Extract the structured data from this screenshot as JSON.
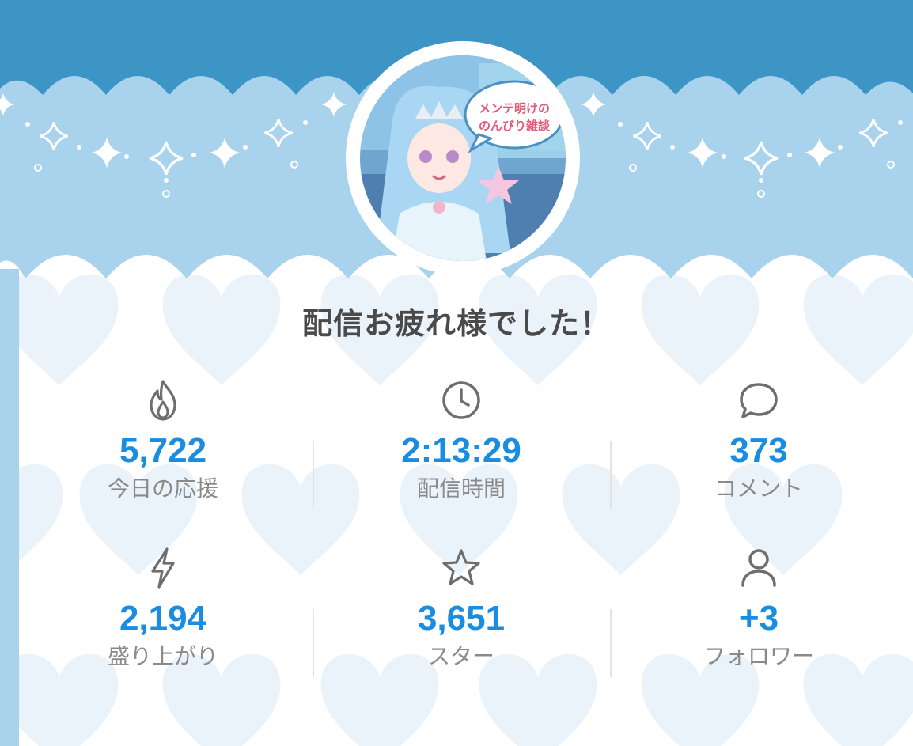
{
  "summary": {
    "title": "配信お疲れ様でした！",
    "thumbnail_caption": [
      "メンテ明けの",
      "のんびり雑談"
    ],
    "stats": [
      {
        "icon": "flame-icon",
        "value": "5,722",
        "label": "今日の応援"
      },
      {
        "icon": "clock-icon",
        "value": "2:13:29",
        "label": "配信時間"
      },
      {
        "icon": "comment-bubble-icon",
        "value": "373",
        "label": "コメント"
      },
      {
        "icon": "lightning-icon",
        "value": "2,194",
        "label": "盛り上がり"
      },
      {
        "icon": "star-icon",
        "value": "3,651",
        "label": "スター"
      },
      {
        "icon": "person-icon",
        "value": "+3",
        "label": "フォロワー"
      }
    ]
  },
  "colors": {
    "header_dark": "#3d95c6",
    "header_light": "#a9d3ec",
    "heart_fill": "#eaf3fa",
    "accent_value": "#1a8de0",
    "label_gray": "#8a8a8a",
    "icon_gray": "#6e6e6e"
  }
}
